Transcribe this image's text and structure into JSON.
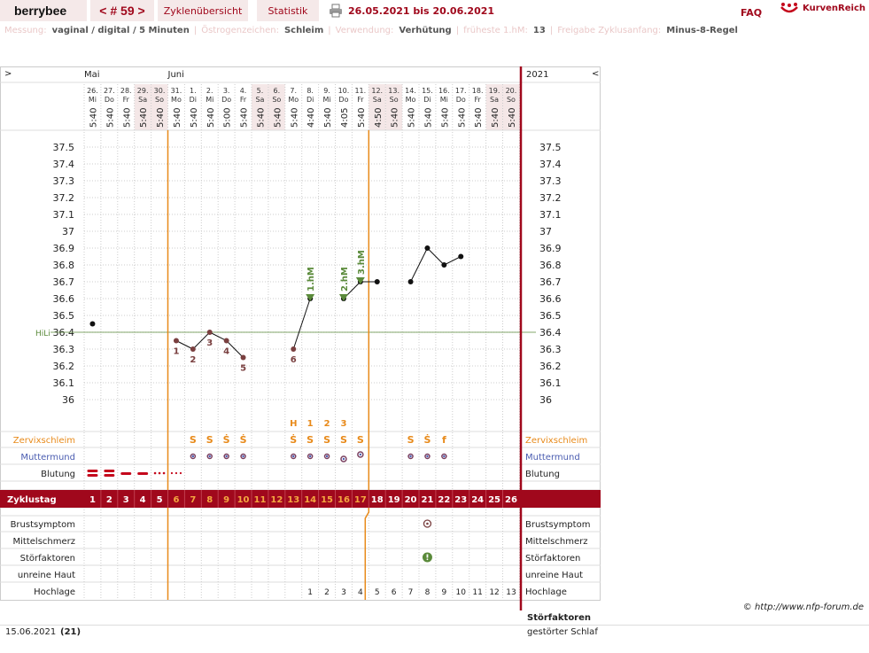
{
  "header": {
    "user": "berrybee",
    "cycle_nav": "< # 59 >",
    "tab_overview": "Zyklenübersicht",
    "tab_stats": "Statistik",
    "date_range": "26.05.2021 bis 20.06.2021",
    "faq": "FAQ",
    "brand": "KurvenReich"
  },
  "info": [
    {
      "label": "Messung:",
      "value": "vaginal / digital / 5 Minuten"
    },
    {
      "label": "Östrogenzeichen:",
      "value": "Schleim"
    },
    {
      "label": "Verwendung:",
      "value": "Verhütung"
    },
    {
      "label": "früheste 1.hM:",
      "value": "13"
    },
    {
      "label": "Freigabe Zyklusanfang:",
      "value": "Minus-8-Regel"
    }
  ],
  "chart": {
    "nav_left": ">",
    "nav_right": "<",
    "year": "2021",
    "months": [
      {
        "label": "Mai",
        "col": 0
      },
      {
        "label": "Juni",
        "col": 5
      }
    ],
    "days": [
      {
        "d": "26.",
        "w": "Mi",
        "t": "5:40"
      },
      {
        "d": "27.",
        "w": "Do",
        "t": "5:40"
      },
      {
        "d": "28.",
        "w": "Fr",
        "t": "5:40"
      },
      {
        "d": "29.",
        "w": "Sa",
        "t": "5:40"
      },
      {
        "d": "30.",
        "w": "So",
        "t": "5:40"
      },
      {
        "d": "31.",
        "w": "Mo",
        "t": "5:40"
      },
      {
        "d": "1.",
        "w": "Di",
        "t": "5:40"
      },
      {
        "d": "2.",
        "w": "Mi",
        "t": "5:40"
      },
      {
        "d": "3.",
        "w": "Do",
        "t": "5:00"
      },
      {
        "d": "4.",
        "w": "Fr",
        "t": "5:40"
      },
      {
        "d": "5.",
        "w": "Sa",
        "t": "5:40"
      },
      {
        "d": "6.",
        "w": "So",
        "t": "5:40"
      },
      {
        "d": "7.",
        "w": "Mo",
        "t": "5:40"
      },
      {
        "d": "8.",
        "w": "Di",
        "t": "4:40"
      },
      {
        "d": "9.",
        "w": "Mi",
        "t": "5:40"
      },
      {
        "d": "10.",
        "w": "Do",
        "t": "4:05"
      },
      {
        "d": "11.",
        "w": "Fr",
        "t": "5:40"
      },
      {
        "d": "12.",
        "w": "Sa",
        "t": "4:50"
      },
      {
        "d": "13.",
        "w": "So",
        "t": "5:40"
      },
      {
        "d": "14.",
        "w": "Mo",
        "t": "5:40"
      },
      {
        "d": "15.",
        "w": "Di",
        "t": "5:40"
      },
      {
        "d": "16.",
        "w": "Mi",
        "t": "5:40"
      },
      {
        "d": "17.",
        "w": "Do",
        "t": "5:40"
      },
      {
        "d": "18.",
        "w": "Fr",
        "t": "5:40"
      },
      {
        "d": "19.",
        "w": "Sa",
        "t": "5:40"
      },
      {
        "d": "20.",
        "w": "So",
        "t": "5:40"
      }
    ],
    "shaded_cols": [
      3,
      4,
      10,
      11,
      17,
      18,
      24,
      25
    ],
    "hili_label": "HiLi",
    "rows": {
      "zervix": "Zervixschleim",
      "mumu": "Muttermund",
      "blutung": "Blutung",
      "zyklustag": "Zyklustag",
      "brust": "Brustsymptom",
      "mittel": "Mittelschmerz",
      "stoer": "Störfaktoren",
      "haut": "unreine Haut",
      "hoch": "Hochlage"
    },
    "cervix_symbols": [
      "",
      "",
      "",
      "",
      "",
      "",
      "S",
      "S",
      "Ṡ",
      "Ṡ",
      "",
      "",
      "Ṡ",
      "S",
      "S",
      "S",
      "S",
      "",
      "",
      "S",
      "Ṡ",
      "f",
      "",
      "",
      "",
      ""
    ],
    "cervix_markers": [
      "",
      "",
      "",
      "",
      "",
      "",
      "",
      "",
      "",
      "",
      "",
      "",
      "H",
      "1",
      "2",
      "3",
      "",
      "",
      "",
      "",
      "",
      "",
      "",
      "",
      "",
      ""
    ],
    "hochlage": [
      "",
      "",
      "",
      "",
      "",
      "",
      "",
      "",
      "",
      "",
      "",
      "",
      "",
      "1",
      "2",
      "3",
      "4",
      "5",
      "6",
      "7",
      "8",
      "9",
      "10",
      "11",
      "12",
      "13"
    ],
    "cycle_days": [
      "1",
      "2",
      "3",
      "4",
      "5",
      "6",
      "7",
      "8",
      "9",
      "10",
      "11",
      "12",
      "13",
      "14",
      "15",
      "16",
      "17",
      "18",
      "19",
      "20",
      "21",
      "22",
      "23",
      "24",
      "25",
      "26"
    ]
  },
  "chart_data": {
    "type": "line",
    "title": "",
    "x": [
      "26.05",
      "27.05",
      "28.05",
      "29.05",
      "30.05",
      "31.05",
      "01.06",
      "02.06",
      "03.06",
      "04.06",
      "05.06",
      "06.06",
      "07.06",
      "08.06",
      "09.06",
      "10.06",
      "11.06",
      "12.06",
      "13.06",
      "14.06",
      "15.06",
      "16.06",
      "17.06",
      "18.06",
      "19.06",
      "20.06"
    ],
    "series": [
      {
        "values": [
          36.45,
          null,
          null,
          null,
          null,
          36.35,
          36.3,
          36.4,
          36.35,
          36.25,
          null,
          null,
          36.3,
          36.6,
          null,
          36.6,
          36.7,
          36.7,
          null,
          36.7,
          36.9,
          36.8,
          36.85,
          null,
          null,
          null
        ]
      }
    ],
    "yticks": [
      36,
      36.1,
      36.2,
      36.3,
      36.4,
      36.5,
      36.6,
      36.7,
      36.8,
      36.9,
      37,
      37.1,
      37.2,
      37.3,
      37.4,
      37.5
    ],
    "ylim": [
      35.9,
      37.6
    ],
    "coverline": 36.4,
    "low_labels": [
      {
        "col": 5,
        "label": "1"
      },
      {
        "col": 6,
        "label": "2"
      },
      {
        "col": 7,
        "label": "3"
      },
      {
        "col": 8,
        "label": "4"
      },
      {
        "col": 9,
        "label": "5"
      },
      {
        "col": 12,
        "label": "6"
      }
    ],
    "high_markers": [
      {
        "col": 13,
        "label": "1.hM"
      },
      {
        "col": 15,
        "label": "2.hM"
      },
      {
        "col": 16,
        "label": "3.hM"
      }
    ],
    "bleeding": [
      "heavy",
      "heavy",
      "medium",
      "medium",
      "light",
      "spotting",
      "",
      "",
      "",
      "",
      "",
      "",
      "",
      "",
      "",
      "",
      "",
      "",
      "",
      "",
      "",
      "",
      "",
      "",
      "",
      ""
    ],
    "cervix_os": [
      "",
      "",
      "",
      "",
      "",
      "",
      "low-closed",
      "low-closed",
      "low-closed",
      "low",
      "",
      "",
      "low",
      "low",
      "low",
      "low-open",
      "mid-closed",
      "",
      "",
      "low",
      "low",
      "low",
      "",
      "",
      "",
      ""
    ],
    "brust_col": 20,
    "stoer_col": 20
  },
  "footer": {
    "copyright": "© http://www.nfp-forum.de",
    "date": "15.06.2021",
    "day": "(21)",
    "disturb_title": "Störfaktoren",
    "disturb_text": "gestörter Schlaf"
  },
  "colors": {
    "accent": "#a0081c",
    "orange": "#e88a1a",
    "green": "#5a8a3a",
    "blue": "#4a5cb0",
    "muted": "#eac8c8"
  }
}
